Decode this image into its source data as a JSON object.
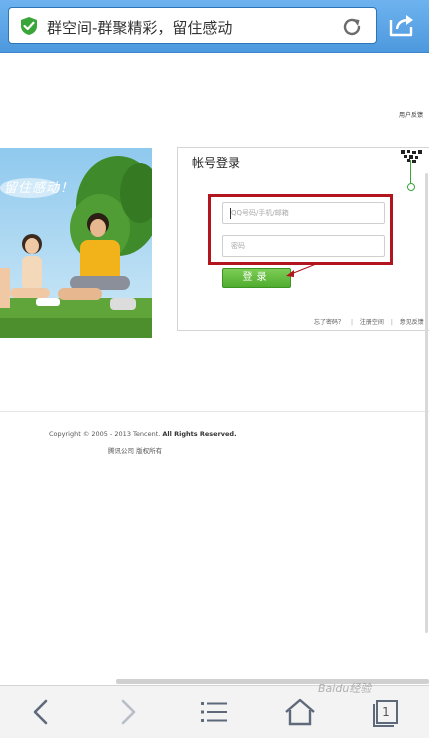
{
  "browser": {
    "page_title": "群空间-群聚精彩，留住感动",
    "secure_icon": "shield-check-icon",
    "reload_icon": "reload-icon",
    "share_icon": "share-icon"
  },
  "header_link": "用户反馈",
  "banner": {
    "slogan": "留住感动！"
  },
  "login": {
    "title": "帐号登录",
    "username_placeholder": "QQ号码/手机/邮箱",
    "password_placeholder": "密码",
    "submit_label": "登录",
    "forgot_label": "忘了密码？",
    "separator": "|",
    "register_label": "注册空间",
    "feedback_label": "意见反馈"
  },
  "footer": {
    "copyright_prefix": "Copyright © 2005 - 2013 Tencent.",
    "copyright_rights": "All Rights Reserved.",
    "company": "腾讯公司 版权所有"
  },
  "toolbar": {
    "tab_count": "1",
    "icons": [
      "back-icon",
      "forward-icon",
      "menu-icon",
      "home-icon",
      "tabs-icon"
    ]
  },
  "watermark": "Baidu经验",
  "colors": {
    "topbar": "#5aa5e8",
    "accent_green": "#4fac2e",
    "highlight_red": "#b2151e"
  }
}
